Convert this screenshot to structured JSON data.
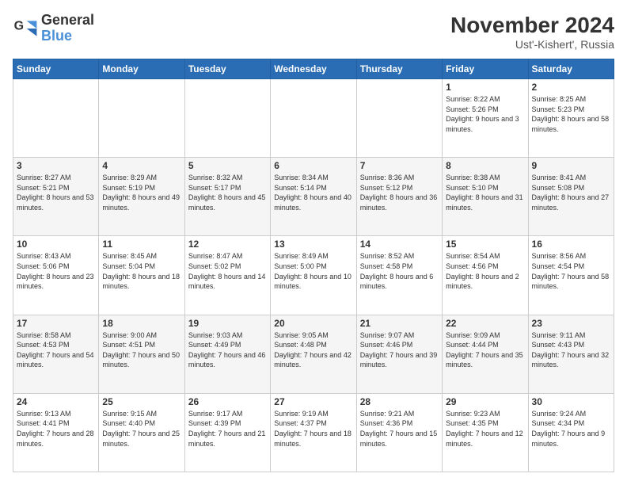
{
  "logo": {
    "line1": "General",
    "line2": "Blue"
  },
  "title": "November 2024",
  "subtitle": "Ust'-Kishert', Russia",
  "days_of_week": [
    "Sunday",
    "Monday",
    "Tuesday",
    "Wednesday",
    "Thursday",
    "Friday",
    "Saturday"
  ],
  "weeks": [
    [
      {
        "day": "",
        "info": ""
      },
      {
        "day": "",
        "info": ""
      },
      {
        "day": "",
        "info": ""
      },
      {
        "day": "",
        "info": ""
      },
      {
        "day": "",
        "info": ""
      },
      {
        "day": "1",
        "info": "Sunrise: 8:22 AM\nSunset: 5:26 PM\nDaylight: 9 hours\nand 3 minutes."
      },
      {
        "day": "2",
        "info": "Sunrise: 8:25 AM\nSunset: 5:23 PM\nDaylight: 8 hours\nand 58 minutes."
      }
    ],
    [
      {
        "day": "3",
        "info": "Sunrise: 8:27 AM\nSunset: 5:21 PM\nDaylight: 8 hours\nand 53 minutes."
      },
      {
        "day": "4",
        "info": "Sunrise: 8:29 AM\nSunset: 5:19 PM\nDaylight: 8 hours\nand 49 minutes."
      },
      {
        "day": "5",
        "info": "Sunrise: 8:32 AM\nSunset: 5:17 PM\nDaylight: 8 hours\nand 45 minutes."
      },
      {
        "day": "6",
        "info": "Sunrise: 8:34 AM\nSunset: 5:14 PM\nDaylight: 8 hours\nand 40 minutes."
      },
      {
        "day": "7",
        "info": "Sunrise: 8:36 AM\nSunset: 5:12 PM\nDaylight: 8 hours\nand 36 minutes."
      },
      {
        "day": "8",
        "info": "Sunrise: 8:38 AM\nSunset: 5:10 PM\nDaylight: 8 hours\nand 31 minutes."
      },
      {
        "day": "9",
        "info": "Sunrise: 8:41 AM\nSunset: 5:08 PM\nDaylight: 8 hours\nand 27 minutes."
      }
    ],
    [
      {
        "day": "10",
        "info": "Sunrise: 8:43 AM\nSunset: 5:06 PM\nDaylight: 8 hours\nand 23 minutes."
      },
      {
        "day": "11",
        "info": "Sunrise: 8:45 AM\nSunset: 5:04 PM\nDaylight: 8 hours\nand 18 minutes."
      },
      {
        "day": "12",
        "info": "Sunrise: 8:47 AM\nSunset: 5:02 PM\nDaylight: 8 hours\nand 14 minutes."
      },
      {
        "day": "13",
        "info": "Sunrise: 8:49 AM\nSunset: 5:00 PM\nDaylight: 8 hours\nand 10 minutes."
      },
      {
        "day": "14",
        "info": "Sunrise: 8:52 AM\nSunset: 4:58 PM\nDaylight: 8 hours\nand 6 minutes."
      },
      {
        "day": "15",
        "info": "Sunrise: 8:54 AM\nSunset: 4:56 PM\nDaylight: 8 hours\nand 2 minutes."
      },
      {
        "day": "16",
        "info": "Sunrise: 8:56 AM\nSunset: 4:54 PM\nDaylight: 7 hours\nand 58 minutes."
      }
    ],
    [
      {
        "day": "17",
        "info": "Sunrise: 8:58 AM\nSunset: 4:53 PM\nDaylight: 7 hours\nand 54 minutes."
      },
      {
        "day": "18",
        "info": "Sunrise: 9:00 AM\nSunset: 4:51 PM\nDaylight: 7 hours\nand 50 minutes."
      },
      {
        "day": "19",
        "info": "Sunrise: 9:03 AM\nSunset: 4:49 PM\nDaylight: 7 hours\nand 46 minutes."
      },
      {
        "day": "20",
        "info": "Sunrise: 9:05 AM\nSunset: 4:48 PM\nDaylight: 7 hours\nand 42 minutes."
      },
      {
        "day": "21",
        "info": "Sunrise: 9:07 AM\nSunset: 4:46 PM\nDaylight: 7 hours\nand 39 minutes."
      },
      {
        "day": "22",
        "info": "Sunrise: 9:09 AM\nSunset: 4:44 PM\nDaylight: 7 hours\nand 35 minutes."
      },
      {
        "day": "23",
        "info": "Sunrise: 9:11 AM\nSunset: 4:43 PM\nDaylight: 7 hours\nand 32 minutes."
      }
    ],
    [
      {
        "day": "24",
        "info": "Sunrise: 9:13 AM\nSunset: 4:41 PM\nDaylight: 7 hours\nand 28 minutes."
      },
      {
        "day": "25",
        "info": "Sunrise: 9:15 AM\nSunset: 4:40 PM\nDaylight: 7 hours\nand 25 minutes."
      },
      {
        "day": "26",
        "info": "Sunrise: 9:17 AM\nSunset: 4:39 PM\nDaylight: 7 hours\nand 21 minutes."
      },
      {
        "day": "27",
        "info": "Sunrise: 9:19 AM\nSunset: 4:37 PM\nDaylight: 7 hours\nand 18 minutes."
      },
      {
        "day": "28",
        "info": "Sunrise: 9:21 AM\nSunset: 4:36 PM\nDaylight: 7 hours\nand 15 minutes."
      },
      {
        "day": "29",
        "info": "Sunrise: 9:23 AM\nSunset: 4:35 PM\nDaylight: 7 hours\nand 12 minutes."
      },
      {
        "day": "30",
        "info": "Sunrise: 9:24 AM\nSunset: 4:34 PM\nDaylight: 7 hours\nand 9 minutes."
      }
    ]
  ]
}
